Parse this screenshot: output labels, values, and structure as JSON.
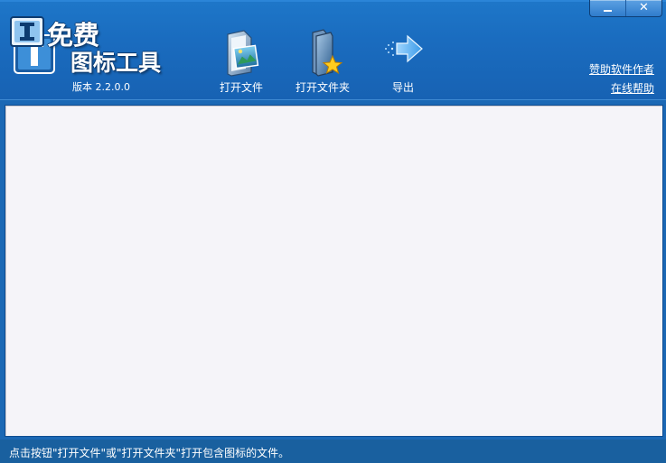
{
  "app": {
    "logo_line1": "免费",
    "logo_line2": "图标工具",
    "version": "版本 2.2.0.0"
  },
  "window_controls": {
    "minimize_icon": "minimize-icon",
    "close_glyph": "✕"
  },
  "toolbar": {
    "open_file_label": "打开文件",
    "open_folder_label": "打开文件夹",
    "export_label": "导出"
  },
  "links": {
    "sponsor": "赞助软件作者",
    "help": "在线帮助"
  },
  "status_bar": {
    "text": "点击按钮\"打开文件\"或\"打开文件夹\"打开包含图标的文件。"
  },
  "colors": {
    "header_bg": "#1a6cbf",
    "content_bg": "#f5f4f9",
    "status_bg": "#19609f",
    "text": "#ffffff"
  }
}
